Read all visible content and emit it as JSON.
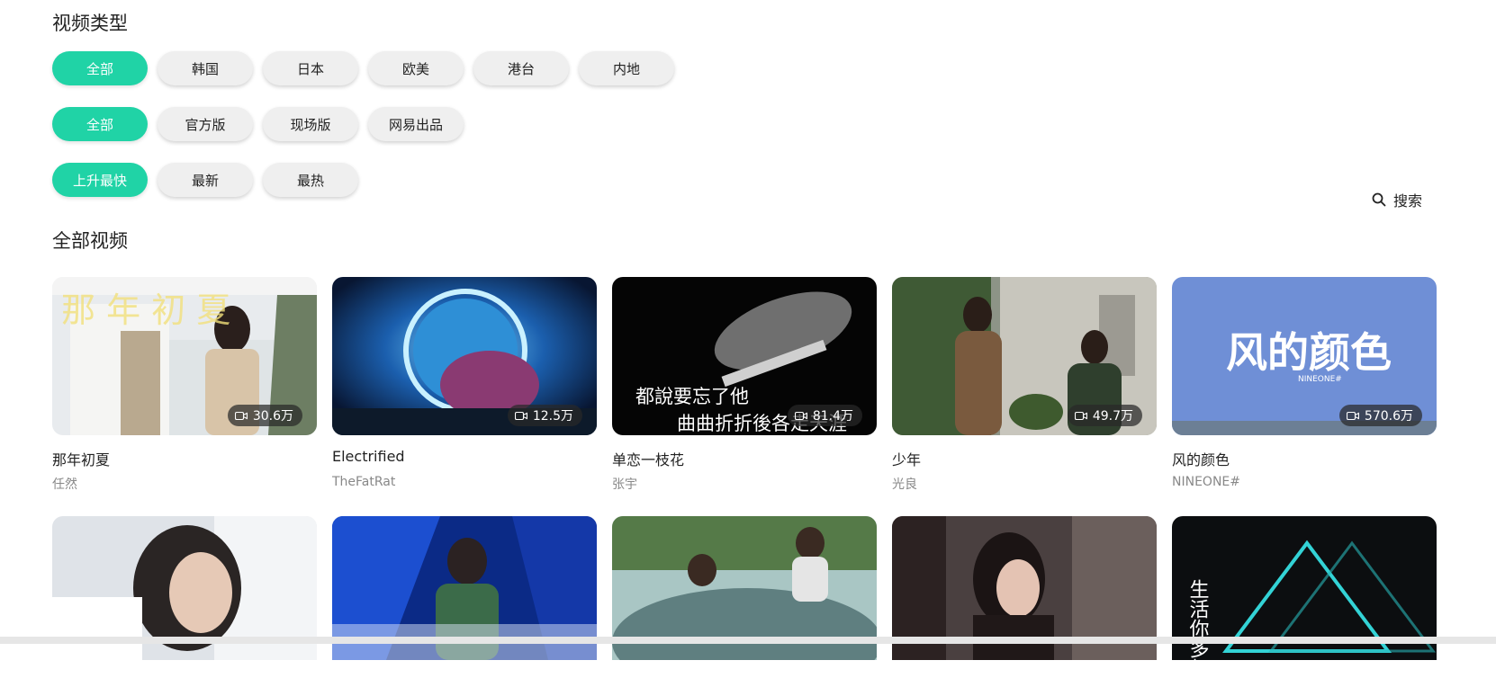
{
  "filters": {
    "title": "视频类型",
    "regions": [
      {
        "label": "全部",
        "active": true
      },
      {
        "label": "韩国",
        "active": false
      },
      {
        "label": "日本",
        "active": false
      },
      {
        "label": "欧美",
        "active": false
      },
      {
        "label": "港台",
        "active": false
      },
      {
        "label": "内地",
        "active": false
      }
    ],
    "versions": [
      {
        "label": "全部",
        "active": true
      },
      {
        "label": "官方版",
        "active": false
      },
      {
        "label": "现场版",
        "active": false
      },
      {
        "label": "网易出品",
        "active": false
      }
    ],
    "sorts": [
      {
        "label": "上升最快",
        "active": true
      },
      {
        "label": "最新",
        "active": false
      },
      {
        "label": "最热",
        "active": false
      }
    ]
  },
  "search": {
    "label": "搜索"
  },
  "videos_section": {
    "title": "全部视频"
  },
  "videos": [
    {
      "title": "那年初夏",
      "artist": "任然",
      "views": "30.6万",
      "overlay": "那 年 初 夏"
    },
    {
      "title": "Electrified",
      "artist": "TheFatRat",
      "views": "12.5万"
    },
    {
      "title": "单恋一枝花",
      "artist": "张宇",
      "views": "81.4万",
      "caption_line1": "都說要忘了他",
      "caption_line2": "曲曲折折後各走天涯"
    },
    {
      "title": "少年",
      "artist": "光良",
      "views": "49.7万"
    },
    {
      "title": "风的颜色",
      "artist": "NINEONE#",
      "views": "570.6万",
      "art_title": "风的颜色",
      "art_sub": "NINEONE#"
    }
  ],
  "videos_row2": [
    {
      "name": "video-6"
    },
    {
      "name": "video-7"
    },
    {
      "name": "video-8"
    },
    {
      "name": "video-9"
    },
    {
      "art_text": "生活你多想"
    }
  ],
  "colors": {
    "accent": "#20d3a6",
    "tag_bg": "#efefef",
    "muted": "#888888"
  }
}
